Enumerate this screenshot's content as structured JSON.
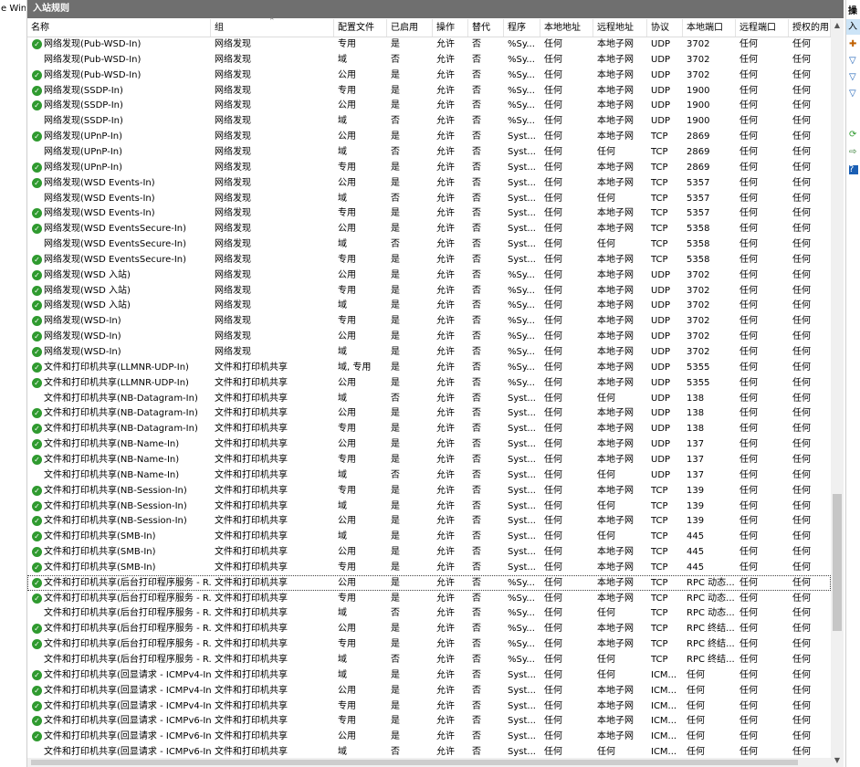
{
  "left_stub": "e Win",
  "panel_title": "入站规则",
  "columns": [
    "名称",
    "组",
    "配置文件",
    "已启用",
    "操作",
    "替代",
    "程序",
    "本地地址",
    "远程地址",
    "协议",
    "本地端口",
    "远程端口",
    "授权的用"
  ],
  "right_pane": {
    "title": "操",
    "selected": "入"
  },
  "rows": [
    {
      "name": "网络发现(Pub-WSD-In)",
      "group": "网络发现",
      "profile": "专用",
      "enabled": "是",
      "action": "允许",
      "override": "否",
      "program": "%Sy...",
      "local_addr": "任何",
      "remote_addr": "本地子网",
      "protocol": "UDP",
      "local_port": "3702",
      "remote_port": "任何",
      "auth": "任何"
    },
    {
      "name": "网络发现(Pub-WSD-In)",
      "group": "网络发现",
      "profile": "域",
      "enabled": "否",
      "action": "允许",
      "override": "否",
      "program": "%Sy...",
      "local_addr": "任何",
      "remote_addr": "本地子网",
      "protocol": "UDP",
      "local_port": "3702",
      "remote_port": "任何",
      "auth": "任何"
    },
    {
      "name": "网络发现(Pub-WSD-In)",
      "group": "网络发现",
      "profile": "公用",
      "enabled": "是",
      "action": "允许",
      "override": "否",
      "program": "%Sy...",
      "local_addr": "任何",
      "remote_addr": "本地子网",
      "protocol": "UDP",
      "local_port": "3702",
      "remote_port": "任何",
      "auth": "任何"
    },
    {
      "name": "网络发现(SSDP-In)",
      "group": "网络发现",
      "profile": "专用",
      "enabled": "是",
      "action": "允许",
      "override": "否",
      "program": "%Sy...",
      "local_addr": "任何",
      "remote_addr": "本地子网",
      "protocol": "UDP",
      "local_port": "1900",
      "remote_port": "任何",
      "auth": "任何"
    },
    {
      "name": "网络发现(SSDP-In)",
      "group": "网络发现",
      "profile": "公用",
      "enabled": "是",
      "action": "允许",
      "override": "否",
      "program": "%Sy...",
      "local_addr": "任何",
      "remote_addr": "本地子网",
      "protocol": "UDP",
      "local_port": "1900",
      "remote_port": "任何",
      "auth": "任何"
    },
    {
      "name": "网络发现(SSDP-In)",
      "group": "网络发现",
      "profile": "域",
      "enabled": "否",
      "action": "允许",
      "override": "否",
      "program": "%Sy...",
      "local_addr": "任何",
      "remote_addr": "本地子网",
      "protocol": "UDP",
      "local_port": "1900",
      "remote_port": "任何",
      "auth": "任何"
    },
    {
      "name": "网络发现(UPnP-In)",
      "group": "网络发现",
      "profile": "公用",
      "enabled": "是",
      "action": "允许",
      "override": "否",
      "program": "Syst...",
      "local_addr": "任何",
      "remote_addr": "本地子网",
      "protocol": "TCP",
      "local_port": "2869",
      "remote_port": "任何",
      "auth": "任何"
    },
    {
      "name": "网络发现(UPnP-In)",
      "group": "网络发现",
      "profile": "域",
      "enabled": "否",
      "action": "允许",
      "override": "否",
      "program": "Syst...",
      "local_addr": "任何",
      "remote_addr": "任何",
      "protocol": "TCP",
      "local_port": "2869",
      "remote_port": "任何",
      "auth": "任何"
    },
    {
      "name": "网络发现(UPnP-In)",
      "group": "网络发现",
      "profile": "专用",
      "enabled": "是",
      "action": "允许",
      "override": "否",
      "program": "Syst...",
      "local_addr": "任何",
      "remote_addr": "本地子网",
      "protocol": "TCP",
      "local_port": "2869",
      "remote_port": "任何",
      "auth": "任何"
    },
    {
      "name": "网络发现(WSD Events-In)",
      "group": "网络发现",
      "profile": "公用",
      "enabled": "是",
      "action": "允许",
      "override": "否",
      "program": "Syst...",
      "local_addr": "任何",
      "remote_addr": "本地子网",
      "protocol": "TCP",
      "local_port": "5357",
      "remote_port": "任何",
      "auth": "任何"
    },
    {
      "name": "网络发现(WSD Events-In)",
      "group": "网络发现",
      "profile": "域",
      "enabled": "否",
      "action": "允许",
      "override": "否",
      "program": "Syst...",
      "local_addr": "任何",
      "remote_addr": "任何",
      "protocol": "TCP",
      "local_port": "5357",
      "remote_port": "任何",
      "auth": "任何"
    },
    {
      "name": "网络发现(WSD Events-In)",
      "group": "网络发现",
      "profile": "专用",
      "enabled": "是",
      "action": "允许",
      "override": "否",
      "program": "Syst...",
      "local_addr": "任何",
      "remote_addr": "本地子网",
      "protocol": "TCP",
      "local_port": "5357",
      "remote_port": "任何",
      "auth": "任何"
    },
    {
      "name": "网络发现(WSD EventsSecure-In)",
      "group": "网络发现",
      "profile": "公用",
      "enabled": "是",
      "action": "允许",
      "override": "否",
      "program": "Syst...",
      "local_addr": "任何",
      "remote_addr": "本地子网",
      "protocol": "TCP",
      "local_port": "5358",
      "remote_port": "任何",
      "auth": "任何"
    },
    {
      "name": "网络发现(WSD EventsSecure-In)",
      "group": "网络发现",
      "profile": "域",
      "enabled": "否",
      "action": "允许",
      "override": "否",
      "program": "Syst...",
      "local_addr": "任何",
      "remote_addr": "任何",
      "protocol": "TCP",
      "local_port": "5358",
      "remote_port": "任何",
      "auth": "任何"
    },
    {
      "name": "网络发现(WSD EventsSecure-In)",
      "group": "网络发现",
      "profile": "专用",
      "enabled": "是",
      "action": "允许",
      "override": "否",
      "program": "Syst...",
      "local_addr": "任何",
      "remote_addr": "本地子网",
      "protocol": "TCP",
      "local_port": "5358",
      "remote_port": "任何",
      "auth": "任何"
    },
    {
      "name": "网络发现(WSD 入站)",
      "group": "网络发现",
      "profile": "公用",
      "enabled": "是",
      "action": "允许",
      "override": "否",
      "program": "%Sy...",
      "local_addr": "任何",
      "remote_addr": "本地子网",
      "protocol": "UDP",
      "local_port": "3702",
      "remote_port": "任何",
      "auth": "任何"
    },
    {
      "name": "网络发现(WSD 入站)",
      "group": "网络发现",
      "profile": "专用",
      "enabled": "是",
      "action": "允许",
      "override": "否",
      "program": "%Sy...",
      "local_addr": "任何",
      "remote_addr": "本地子网",
      "protocol": "UDP",
      "local_port": "3702",
      "remote_port": "任何",
      "auth": "任何"
    },
    {
      "name": "网络发现(WSD 入站)",
      "group": "网络发现",
      "profile": "域",
      "enabled": "是",
      "action": "允许",
      "override": "否",
      "program": "%Sy...",
      "local_addr": "任何",
      "remote_addr": "本地子网",
      "protocol": "UDP",
      "local_port": "3702",
      "remote_port": "任何",
      "auth": "任何"
    },
    {
      "name": "网络发现(WSD-In)",
      "group": "网络发现",
      "profile": "专用",
      "enabled": "是",
      "action": "允许",
      "override": "否",
      "program": "%Sy...",
      "local_addr": "任何",
      "remote_addr": "本地子网",
      "protocol": "UDP",
      "local_port": "3702",
      "remote_port": "任何",
      "auth": "任何"
    },
    {
      "name": "网络发现(WSD-In)",
      "group": "网络发现",
      "profile": "公用",
      "enabled": "是",
      "action": "允许",
      "override": "否",
      "program": "%Sy...",
      "local_addr": "任何",
      "remote_addr": "本地子网",
      "protocol": "UDP",
      "local_port": "3702",
      "remote_port": "任何",
      "auth": "任何"
    },
    {
      "name": "网络发现(WSD-In)",
      "group": "网络发现",
      "profile": "域",
      "enabled": "是",
      "action": "允许",
      "override": "否",
      "program": "%Sy...",
      "local_addr": "任何",
      "remote_addr": "本地子网",
      "protocol": "UDP",
      "local_port": "3702",
      "remote_port": "任何",
      "auth": "任何"
    },
    {
      "name": "文件和打印机共享(LLMNR-UDP-In)",
      "group": "文件和打印机共享",
      "profile": "域, 专用",
      "enabled": "是",
      "action": "允许",
      "override": "否",
      "program": "%Sy...",
      "local_addr": "任何",
      "remote_addr": "本地子网",
      "protocol": "UDP",
      "local_port": "5355",
      "remote_port": "任何",
      "auth": "任何"
    },
    {
      "name": "文件和打印机共享(LLMNR-UDP-In)",
      "group": "文件和打印机共享",
      "profile": "公用",
      "enabled": "是",
      "action": "允许",
      "override": "否",
      "program": "%Sy...",
      "local_addr": "任何",
      "remote_addr": "本地子网",
      "protocol": "UDP",
      "local_port": "5355",
      "remote_port": "任何",
      "auth": "任何"
    },
    {
      "name": "文件和打印机共享(NB-Datagram-In)",
      "group": "文件和打印机共享",
      "profile": "域",
      "enabled": "否",
      "action": "允许",
      "override": "否",
      "program": "Syst...",
      "local_addr": "任何",
      "remote_addr": "任何",
      "protocol": "UDP",
      "local_port": "138",
      "remote_port": "任何",
      "auth": "任何"
    },
    {
      "name": "文件和打印机共享(NB-Datagram-In)",
      "group": "文件和打印机共享",
      "profile": "公用",
      "enabled": "是",
      "action": "允许",
      "override": "否",
      "program": "Syst...",
      "local_addr": "任何",
      "remote_addr": "本地子网",
      "protocol": "UDP",
      "local_port": "138",
      "remote_port": "任何",
      "auth": "任何"
    },
    {
      "name": "文件和打印机共享(NB-Datagram-In)",
      "group": "文件和打印机共享",
      "profile": "专用",
      "enabled": "是",
      "action": "允许",
      "override": "否",
      "program": "Syst...",
      "local_addr": "任何",
      "remote_addr": "本地子网",
      "protocol": "UDP",
      "local_port": "138",
      "remote_port": "任何",
      "auth": "任何"
    },
    {
      "name": "文件和打印机共享(NB-Name-In)",
      "group": "文件和打印机共享",
      "profile": "公用",
      "enabled": "是",
      "action": "允许",
      "override": "否",
      "program": "Syst...",
      "local_addr": "任何",
      "remote_addr": "本地子网",
      "protocol": "UDP",
      "local_port": "137",
      "remote_port": "任何",
      "auth": "任何"
    },
    {
      "name": "文件和打印机共享(NB-Name-In)",
      "group": "文件和打印机共享",
      "profile": "专用",
      "enabled": "是",
      "action": "允许",
      "override": "否",
      "program": "Syst...",
      "local_addr": "任何",
      "remote_addr": "本地子网",
      "protocol": "UDP",
      "local_port": "137",
      "remote_port": "任何",
      "auth": "任何"
    },
    {
      "name": "文件和打印机共享(NB-Name-In)",
      "group": "文件和打印机共享",
      "profile": "域",
      "enabled": "否",
      "action": "允许",
      "override": "否",
      "program": "Syst...",
      "local_addr": "任何",
      "remote_addr": "任何",
      "protocol": "UDP",
      "local_port": "137",
      "remote_port": "任何",
      "auth": "任何"
    },
    {
      "name": "文件和打印机共享(NB-Session-In)",
      "group": "文件和打印机共享",
      "profile": "专用",
      "enabled": "是",
      "action": "允许",
      "override": "否",
      "program": "Syst...",
      "local_addr": "任何",
      "remote_addr": "本地子网",
      "protocol": "TCP",
      "local_port": "139",
      "remote_port": "任何",
      "auth": "任何"
    },
    {
      "name": "文件和打印机共享(NB-Session-In)",
      "group": "文件和打印机共享",
      "profile": "域",
      "enabled": "是",
      "action": "允许",
      "override": "否",
      "program": "Syst...",
      "local_addr": "任何",
      "remote_addr": "任何",
      "protocol": "TCP",
      "local_port": "139",
      "remote_port": "任何",
      "auth": "任何"
    },
    {
      "name": "文件和打印机共享(NB-Session-In)",
      "group": "文件和打印机共享",
      "profile": "公用",
      "enabled": "是",
      "action": "允许",
      "override": "否",
      "program": "Syst...",
      "local_addr": "任何",
      "remote_addr": "本地子网",
      "protocol": "TCP",
      "local_port": "139",
      "remote_port": "任何",
      "auth": "任何"
    },
    {
      "name": "文件和打印机共享(SMB-In)",
      "group": "文件和打印机共享",
      "profile": "域",
      "enabled": "是",
      "action": "允许",
      "override": "否",
      "program": "Syst...",
      "local_addr": "任何",
      "remote_addr": "任何",
      "protocol": "TCP",
      "local_port": "445",
      "remote_port": "任何",
      "auth": "任何"
    },
    {
      "name": "文件和打印机共享(SMB-In)",
      "group": "文件和打印机共享",
      "profile": "公用",
      "enabled": "是",
      "action": "允许",
      "override": "否",
      "program": "Syst...",
      "local_addr": "任何",
      "remote_addr": "本地子网",
      "protocol": "TCP",
      "local_port": "445",
      "remote_port": "任何",
      "auth": "任何"
    },
    {
      "name": "文件和打印机共享(SMB-In)",
      "group": "文件和打印机共享",
      "profile": "专用",
      "enabled": "是",
      "action": "允许",
      "override": "否",
      "program": "Syst...",
      "local_addr": "任何",
      "remote_addr": "本地子网",
      "protocol": "TCP",
      "local_port": "445",
      "remote_port": "任何",
      "auth": "任何"
    },
    {
      "name": "文件和打印机共享(后台打印程序服务 - R...",
      "group": "文件和打印机共享",
      "profile": "公用",
      "enabled": "是",
      "action": "允许",
      "override": "否",
      "program": "%Sy...",
      "local_addr": "任何",
      "remote_addr": "本地子网",
      "protocol": "TCP",
      "local_port": "RPC 动态...",
      "remote_port": "任何",
      "auth": "任何",
      "selected": true
    },
    {
      "name": "文件和打印机共享(后台打印程序服务 - R...",
      "group": "文件和打印机共享",
      "profile": "专用",
      "enabled": "是",
      "action": "允许",
      "override": "否",
      "program": "%Sy...",
      "local_addr": "任何",
      "remote_addr": "本地子网",
      "protocol": "TCP",
      "local_port": "RPC 动态...",
      "remote_port": "任何",
      "auth": "任何"
    },
    {
      "name": "文件和打印机共享(后台打印程序服务 - R...",
      "group": "文件和打印机共享",
      "profile": "域",
      "enabled": "否",
      "action": "允许",
      "override": "否",
      "program": "%Sy...",
      "local_addr": "任何",
      "remote_addr": "任何",
      "protocol": "TCP",
      "local_port": "RPC 动态...",
      "remote_port": "任何",
      "auth": "任何"
    },
    {
      "name": "文件和打印机共享(后台打印程序服务 - R...",
      "group": "文件和打印机共享",
      "profile": "公用",
      "enabled": "是",
      "action": "允许",
      "override": "否",
      "program": "%Sy...",
      "local_addr": "任何",
      "remote_addr": "本地子网",
      "protocol": "TCP",
      "local_port": "RPC 终结...",
      "remote_port": "任何",
      "auth": "任何"
    },
    {
      "name": "文件和打印机共享(后台打印程序服务 - R...",
      "group": "文件和打印机共享",
      "profile": "专用",
      "enabled": "是",
      "action": "允许",
      "override": "否",
      "program": "%Sy...",
      "local_addr": "任何",
      "remote_addr": "本地子网",
      "protocol": "TCP",
      "local_port": "RPC 终结...",
      "remote_port": "任何",
      "auth": "任何"
    },
    {
      "name": "文件和打印机共享(后台打印程序服务 - R...",
      "group": "文件和打印机共享",
      "profile": "域",
      "enabled": "否",
      "action": "允许",
      "override": "否",
      "program": "%Sy...",
      "local_addr": "任何",
      "remote_addr": "任何",
      "protocol": "TCP",
      "local_port": "RPC 终结...",
      "remote_port": "任何",
      "auth": "任何"
    },
    {
      "name": "文件和打印机共享(回显请求 - ICMPv4-In)",
      "group": "文件和打印机共享",
      "profile": "域",
      "enabled": "是",
      "action": "允许",
      "override": "否",
      "program": "Syst...",
      "local_addr": "任何",
      "remote_addr": "任何",
      "protocol": "ICM...",
      "local_port": "任何",
      "remote_port": "任何",
      "auth": "任何"
    },
    {
      "name": "文件和打印机共享(回显请求 - ICMPv4-In)",
      "group": "文件和打印机共享",
      "profile": "公用",
      "enabled": "是",
      "action": "允许",
      "override": "否",
      "program": "Syst...",
      "local_addr": "任何",
      "remote_addr": "本地子网",
      "protocol": "ICM...",
      "local_port": "任何",
      "remote_port": "任何",
      "auth": "任何"
    },
    {
      "name": "文件和打印机共享(回显请求 - ICMPv4-In)",
      "group": "文件和打印机共享",
      "profile": "专用",
      "enabled": "是",
      "action": "允许",
      "override": "否",
      "program": "Syst...",
      "local_addr": "任何",
      "remote_addr": "本地子网",
      "protocol": "ICM...",
      "local_port": "任何",
      "remote_port": "任何",
      "auth": "任何"
    },
    {
      "name": "文件和打印机共享(回显请求 - ICMPv6-In)",
      "group": "文件和打印机共享",
      "profile": "专用",
      "enabled": "是",
      "action": "允许",
      "override": "否",
      "program": "Syst...",
      "local_addr": "任何",
      "remote_addr": "本地子网",
      "protocol": "ICM...",
      "local_port": "任何",
      "remote_port": "任何",
      "auth": "任何"
    },
    {
      "name": "文件和打印机共享(回显请求 - ICMPv6-In)",
      "group": "文件和打印机共享",
      "profile": "公用",
      "enabled": "是",
      "action": "允许",
      "override": "否",
      "program": "Syst...",
      "local_addr": "任何",
      "remote_addr": "本地子网",
      "protocol": "ICM...",
      "local_port": "任何",
      "remote_port": "任何",
      "auth": "任何"
    },
    {
      "name": "文件和打印机共享(回显请求 - ICMPv6-In)",
      "group": "文件和打印机共享",
      "profile": "域",
      "enabled": "否",
      "action": "允许",
      "override": "否",
      "program": "Syst...",
      "local_addr": "任何",
      "remote_addr": "任何",
      "protocol": "ICM...",
      "local_port": "任何",
      "remote_port": "任何",
      "auth": "任何"
    }
  ]
}
